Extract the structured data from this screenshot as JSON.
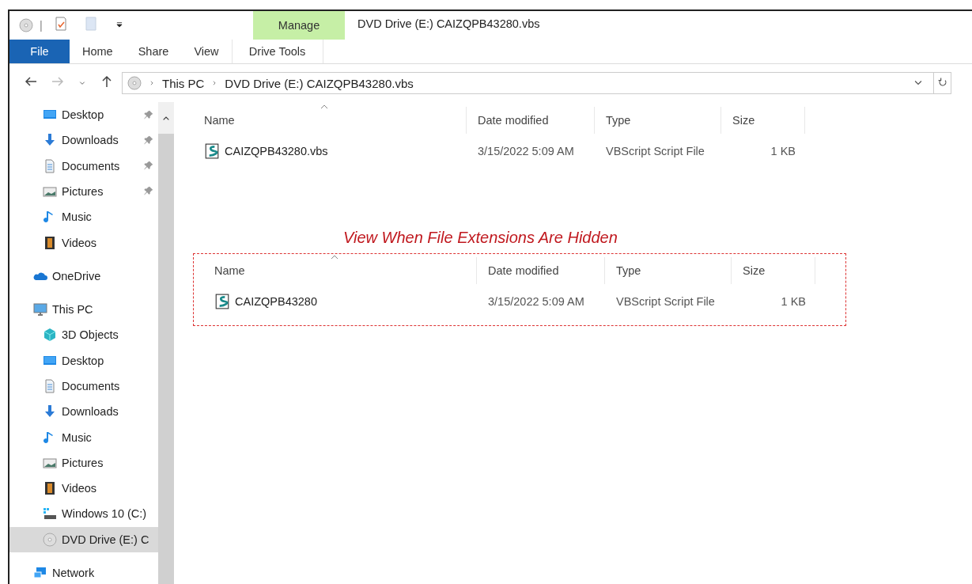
{
  "window": {
    "title": "DVD Drive (E:) CAIZQPB43280.vbs"
  },
  "quick_access_toolbar": {
    "separator_glyph": "|"
  },
  "ribbon": {
    "context_group": "Manage",
    "tabs": [
      {
        "label": "File",
        "kind": "file",
        "selected": false
      },
      {
        "label": "Home",
        "kind": "tab",
        "selected": false
      },
      {
        "label": "Share",
        "kind": "tab",
        "selected": false
      },
      {
        "label": "View",
        "kind": "tab",
        "selected": false
      },
      {
        "label": "Drive Tools",
        "kind": "context",
        "selected": false
      }
    ]
  },
  "address_bar": {
    "path": [
      "This PC",
      "DVD Drive (E:) CAIZQPB43280.vbs"
    ]
  },
  "sidebar": {
    "quick_access": [
      {
        "label": "Desktop",
        "kind": "desktop",
        "pinned": true,
        "selected": false
      },
      {
        "label": "Downloads",
        "kind": "downloads",
        "pinned": true,
        "selected": false
      },
      {
        "label": "Documents",
        "kind": "documents",
        "pinned": true,
        "selected": false
      },
      {
        "label": "Pictures",
        "kind": "pictures",
        "pinned": true,
        "selected": false
      },
      {
        "label": "Music",
        "kind": "music",
        "pinned": false,
        "selected": false
      },
      {
        "label": "Videos",
        "kind": "videos",
        "pinned": false,
        "selected": false
      }
    ],
    "items": [
      {
        "label": "OneDrive",
        "kind": "cloud",
        "selected": false
      },
      {
        "label": "This PC",
        "kind": "pc",
        "selected": false,
        "children": [
          {
            "label": "3D Objects",
            "kind": "objects",
            "selected": false
          },
          {
            "label": "Desktop",
            "kind": "desktop",
            "selected": false
          },
          {
            "label": "Documents",
            "kind": "documents",
            "selected": false
          },
          {
            "label": "Downloads",
            "kind": "downloads",
            "selected": false
          },
          {
            "label": "Music",
            "kind": "music",
            "selected": false
          },
          {
            "label": "Pictures",
            "kind": "pictures",
            "selected": false
          },
          {
            "label": "Videos",
            "kind": "videos",
            "selected": false
          },
          {
            "label": "Windows 10 (C:)",
            "kind": "drive",
            "selected": false
          },
          {
            "label": "DVD Drive (E:) C",
            "kind": "dvd",
            "selected": true
          }
        ]
      },
      {
        "label": "Network",
        "kind": "network",
        "selected": false
      }
    ]
  },
  "file_list": {
    "columns": [
      "Name",
      "Date modified",
      "Type",
      "Size"
    ],
    "rows": [
      {
        "name": "CAIZQPB43280.vbs",
        "date_modified": "3/15/2022 5:09 AM",
        "type": "VBScript Script File",
        "size": "1 KB"
      }
    ]
  },
  "annotation": {
    "caption": "View When File Extensions Are Hidden",
    "columns": [
      "Name",
      "Date modified",
      "Type",
      "Size"
    ],
    "rows": [
      {
        "name": "CAIZQPB43280",
        "date_modified": "3/15/2022 5:09 AM",
        "type": "VBScript Script File",
        "size": "1 KB"
      }
    ]
  }
}
